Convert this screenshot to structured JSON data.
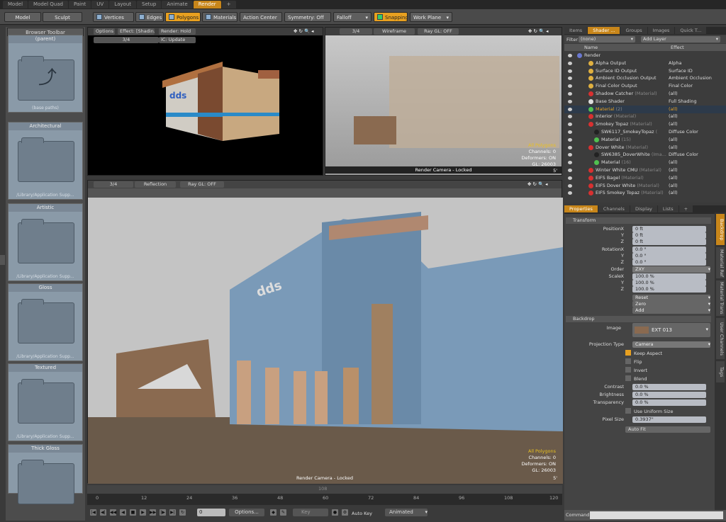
{
  "top_tabs": [
    "Model",
    "Model Quad",
    "Paint",
    "UV",
    "Layout",
    "Setup",
    "Animate",
    "Render",
    "+"
  ],
  "active_top_tab": "Render",
  "toolbar": {
    "model": "Model",
    "sculpt": "Sculpt",
    "vertices": "Vertices",
    "edges": "Edges",
    "polygons": "Polygons",
    "materials": "Materials",
    "action_center": "Action Center",
    "symmetry": "Symmetry: Off",
    "falloff": "Falloff",
    "snapping": "Snapping",
    "work_plane": "Work Plane"
  },
  "browser": {
    "title": "Browser Toolbar",
    "cells": [
      {
        "title": "(parent)",
        "sub": "(base paths)"
      },
      {
        "title": "Architectural",
        "sub": "/Library/Application Supp..."
      },
      {
        "title": "Artistic",
        "sub": "/Library/Application Supp..."
      },
      {
        "title": "Gloss",
        "sub": "/Library/Application Supp..."
      },
      {
        "title": "Textured",
        "sub": "/Library/Application Supp..."
      },
      {
        "title": "Thick Gloss",
        "sub": "/Library/Application Supp..."
      }
    ]
  },
  "vp1": {
    "options": "Options",
    "effect": "Effect: [Shadin...",
    "render": "Render: Hold",
    "frac": "3/4",
    "update": "IC: Update"
  },
  "vp2": {
    "frac": "3/4",
    "mode": "Wireframe",
    "raygl": "Ray GL: OFF",
    "stats1": "All Polygons",
    "stats2": "Channels: 0",
    "stats3": "Deformers: ON",
    "stats4": "GL: 26003",
    "camera": "Render Camera - Locked",
    "unit": "5'"
  },
  "vp3": {
    "frac": "3/4",
    "mode": "Reflection",
    "raygl": "Ray GL: OFF",
    "stats1": "All Polygons",
    "stats2": "Channels: 0",
    "stats3": "Deformers: ON",
    "stats4": "GL: 26003",
    "camera": "Render Camera - Locked",
    "unit": "5'"
  },
  "shader": {
    "tabs": [
      "Items",
      "Shader ...",
      "Groups",
      "Images",
      "Quick T..."
    ],
    "filter_label": "Filter",
    "filter_value": "(none)",
    "add_layer": "Add Layer",
    "col_name": "Name",
    "col_effect": "Effect",
    "rows": [
      {
        "name": "Render",
        "tag": "",
        "effect": "",
        "indent": 0,
        "color": "#6a78d0"
      },
      {
        "name": "Alpha Output",
        "tag": "",
        "effect": "Alpha",
        "indent": 2,
        "color": "#e0b040"
      },
      {
        "name": "Surface ID Output",
        "tag": "",
        "effect": "Surface ID",
        "indent": 2,
        "color": "#e0b040"
      },
      {
        "name": "Ambient Occlusion Output",
        "tag": "",
        "effect": "Ambient Occlusion",
        "indent": 2,
        "color": "#e0b040"
      },
      {
        "name": "Final Color Output",
        "tag": "",
        "effect": "Final Color",
        "indent": 2,
        "color": "#e0b040"
      },
      {
        "name": "Shadow Catcher",
        "tag": "(Material)",
        "effect": "(all)",
        "indent": 2,
        "color": "#d83030"
      },
      {
        "name": "Base Shader",
        "tag": "",
        "effect": "Full Shading",
        "indent": 2,
        "color": "#dddddd"
      },
      {
        "name": "Material",
        "tag": "(2)",
        "effect": "(all)",
        "indent": 2,
        "color": "#50c050",
        "selected": true
      },
      {
        "name": "Interior",
        "tag": "(Material)",
        "effect": "(all)",
        "indent": 2,
        "color": "#d83030"
      },
      {
        "name": "Smokey Topaz",
        "tag": "(Material)",
        "effect": "(all)",
        "indent": 2,
        "color": "#d83030"
      },
      {
        "name": "SW6117_SmokeyTopaz",
        "tag": "(",
        "effect": "Diffuse Color",
        "indent": 3,
        "color": "#222222"
      },
      {
        "name": "Material",
        "tag": "(15)",
        "effect": "(all)",
        "indent": 3,
        "color": "#50c050"
      },
      {
        "name": "Dover White",
        "tag": "(Material)",
        "effect": "(all)",
        "indent": 2,
        "color": "#d83030"
      },
      {
        "name": "SW6385_DoverWhite",
        "tag": "(Ima...",
        "effect": "Diffuse Color",
        "indent": 3,
        "color": "#222222"
      },
      {
        "name": "Material",
        "tag": "(16)",
        "effect": "(all)",
        "indent": 3,
        "color": "#50c050"
      },
      {
        "name": "Winter White CMU",
        "tag": "(Material)",
        "effect": "(all)",
        "indent": 2,
        "color": "#d83030"
      },
      {
        "name": "EIFS Bagel",
        "tag": "(Material)",
        "effect": "(all)",
        "indent": 2,
        "color": "#d83030"
      },
      {
        "name": "EIFS Dover White",
        "tag": "(Material)",
        "effect": "(all)",
        "indent": 2,
        "color": "#d83030"
      },
      {
        "name": "EIFS Smokey Topaz",
        "tag": "(Material)",
        "effect": "(all)",
        "indent": 2,
        "color": "#d83030"
      }
    ]
  },
  "props": {
    "tabs": [
      "Properties",
      "Channels",
      "Display",
      "Lists",
      "+"
    ],
    "transform": "Transform",
    "position": "Position",
    "rotation": "Rotation",
    "scale": "Scale",
    "x": "X",
    "y": "Y",
    "z": "Z",
    "pos_x": "0 ft",
    "pos_y": "0 ft",
    "pos_z": "0 ft",
    "rot_x": "0.0 °",
    "rot_y": "0.0 °",
    "rot_z": "0.0 °",
    "order_label": "Order",
    "order": "ZXY",
    "scl_x": "100.0 %",
    "scl_y": "100.0 %",
    "scl_z": "100.0 %",
    "reset": "Reset",
    "zero": "Zero",
    "add": "Add",
    "backdrop": "Backdrop",
    "image_label": "Image",
    "image": "EXT 013",
    "proj_label": "Projection Type",
    "proj": "Camera",
    "keep_aspect": "Keep Aspect",
    "flip": "Flip",
    "invert": "Invert",
    "blend": "Blend",
    "contrast_label": "Contrast",
    "contrast": "0.0 %",
    "brightness_label": "Brightness",
    "brightness": "0.0 %",
    "transparency_label": "Transparency",
    "transparency": "0.0 %",
    "use_uniform": "Use Uniform Size",
    "pixel_label": "Pixel Size",
    "pixel": "0.3937\"",
    "auto_fit": "Auto Fit"
  },
  "side_tabs": [
    "Backdrop",
    "Material Ref",
    "Material Trans",
    "User Channels",
    "Tags"
  ],
  "timeline": {
    "ticks": [
      "0",
      "12",
      "24",
      "36",
      "48",
      "60",
      "72",
      "84",
      "96",
      "108",
      "120"
    ],
    "mid": "108"
  },
  "bottom": {
    "frame": "0",
    "options": "Options...",
    "key": "Key",
    "autokey": "Auto Key",
    "animated": "Animated",
    "command": "Command"
  }
}
